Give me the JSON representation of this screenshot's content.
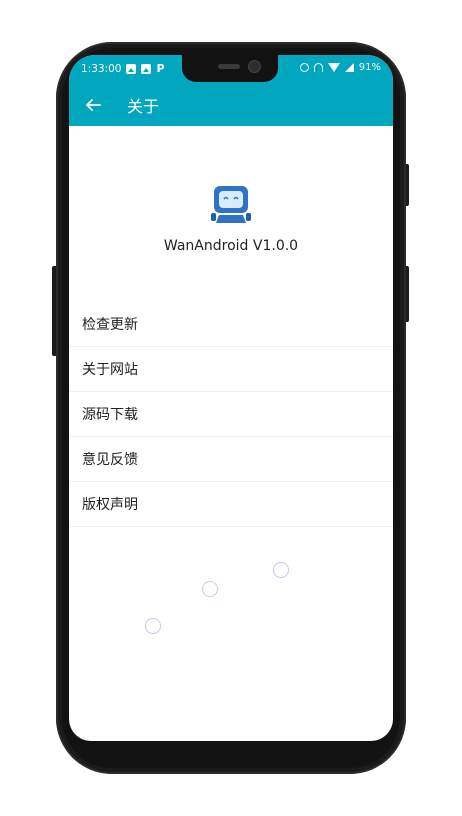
{
  "status_bar": {
    "time": "1:33:00",
    "battery": "91%"
  },
  "app_bar": {
    "title": "关于"
  },
  "about": {
    "app_version": "WanAndroid V1.0.0"
  },
  "menu": {
    "items": [
      {
        "label": "检查更新"
      },
      {
        "label": "关于网站"
      },
      {
        "label": "源码下载"
      },
      {
        "label": "意见反馈"
      },
      {
        "label": "版权声明"
      }
    ]
  },
  "colors": {
    "accent": "#00a7bf",
    "logo_blue": "#2e73c7",
    "loading_ring": "#c8c8ee"
  },
  "icons": [
    "back-arrow-icon",
    "robot-logo-icon",
    "alarm-icon",
    "headset-icon",
    "wifi-icon",
    "signal-icon",
    "gallery-icon",
    "parking-icon"
  ]
}
